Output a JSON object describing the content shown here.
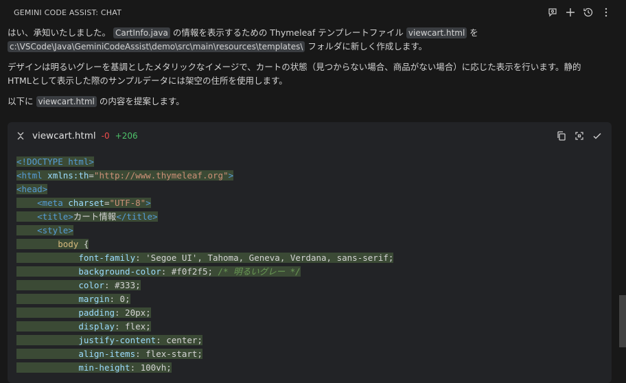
{
  "header": {
    "title": "GEMINI CODE ASSIST: CHAT",
    "icons": [
      "feedback-icon",
      "plus-icon",
      "history-icon",
      "more-icon"
    ]
  },
  "message": {
    "p1": {
      "t1": "はい、承知いたしました。",
      "chip1": "CartInfo.java",
      "t2": "の情報を表示するための Thymeleaf テンプレートファイル",
      "chip2": "viewcart.html",
      "t3": "を",
      "chip3": "c:\\VSCode\\Java\\GeminiCodeAssist\\demo\\src\\main\\resources\\templates\\",
      "t4": "フォルダに新しく作成します。"
    },
    "p2": {
      "line1": "デザインは明るいグレーを基調としたメタリックなイメージで、カートの状態（見つからない場合、商品がない場合）に応じた表示を行います。静的",
      "line2": "HTMLとして表示した際のサンプルデータには架空の住所を使用します。"
    },
    "p3": {
      "t1": "以下に",
      "chip": "viewcart.html",
      "t2": "の内容を提案します。"
    }
  },
  "code_block": {
    "filename": "viewcart.html",
    "removed": "-0",
    "added": "+206",
    "lines": {
      "l1": "<!DOCTYPE html>",
      "l2_open": "<html",
      "l2_attr": "xmlns:th",
      "l2_eq": "=",
      "l2_val": "\"http://www.thymeleaf.org\"",
      "l2_close": ">",
      "l3": "<head>",
      "l4_open": "<meta",
      "l4_attr": "charset",
      "l4_eq": "=",
      "l4_val": "\"UTF-8\"",
      "l4_close": ">",
      "l5_open": "<title>",
      "l5_text": "カート情報",
      "l5_close": "</title>",
      "l6": "<style>",
      "l7_sel": "body",
      "l7_brace": " {",
      "l8_prop": "font-family",
      "l8_val": ": 'Segoe UI', Tahoma, Geneva, Verdana, sans-serif;",
      "l9_prop": "background-color",
      "l9_val": ": #f0f2f5; ",
      "l9_cmt": "/* 明るいグレー */",
      "l10_prop": "color",
      "l10_val": ": #333;",
      "l11_prop": "margin",
      "l11_val": ": 0;",
      "l12_prop": "padding",
      "l12_val": ": 20px;",
      "l13_prop": "display",
      "l13_val": ": flex;",
      "l14_prop": "justify-content",
      "l14_val": ": center;",
      "l15_prop": "align-items",
      "l15_val": ": flex-start;",
      "l16_prop": "min-height",
      "l16_val": ": 100vh;"
    }
  }
}
